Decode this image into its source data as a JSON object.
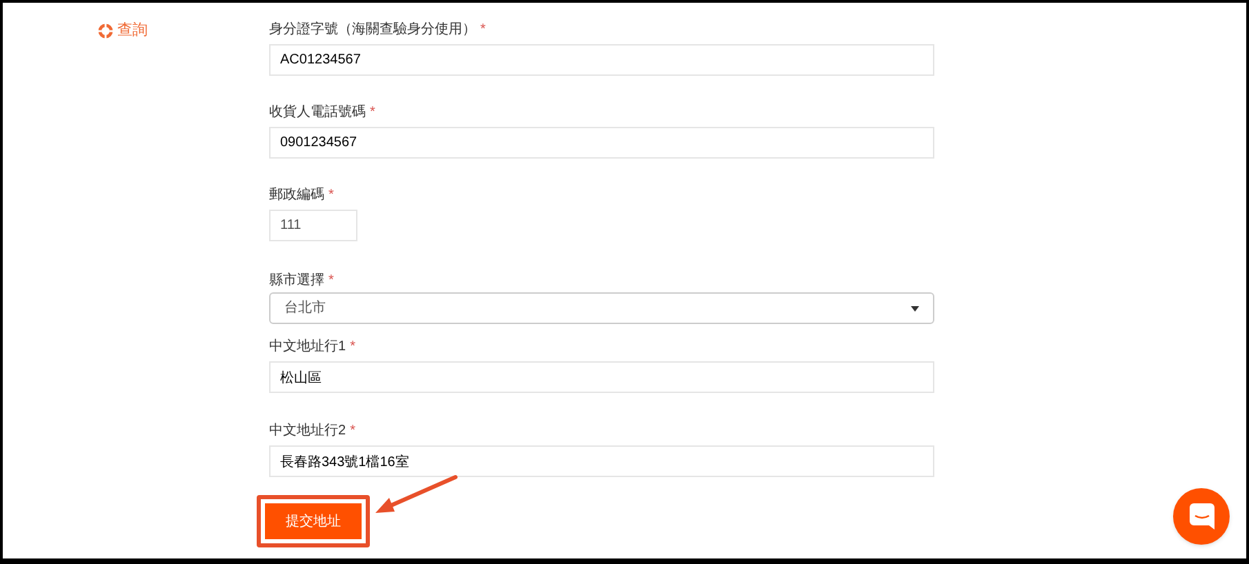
{
  "sidebar": {
    "link": "查詢"
  },
  "fields": [
    {
      "kind": "text",
      "label": "身分證字號（海關查驗身分使用）",
      "required_mark": "*",
      "value": "AC01234567"
    },
    {
      "kind": "text",
      "label": "收貨人電話號碼",
      "required_mark": "*",
      "value": "0901234567"
    },
    {
      "kind": "number",
      "label": "郵政編碼 ",
      "required_mark": "*",
      "value": "111"
    },
    {
      "kind": "select",
      "label": "縣市選擇",
      "required_mark": "*",
      "value": "台北市"
    },
    {
      "kind": "text",
      "label": "中文地址行1",
      "required_mark": "*",
      "value": "松山區"
    },
    {
      "kind": "text",
      "label": "中文地址行2",
      "required_mark": "*",
      "value": "長春路343號1檔16室"
    }
  ],
  "submit": {
    "label": "提交地址",
    "highlighted": true
  }
}
